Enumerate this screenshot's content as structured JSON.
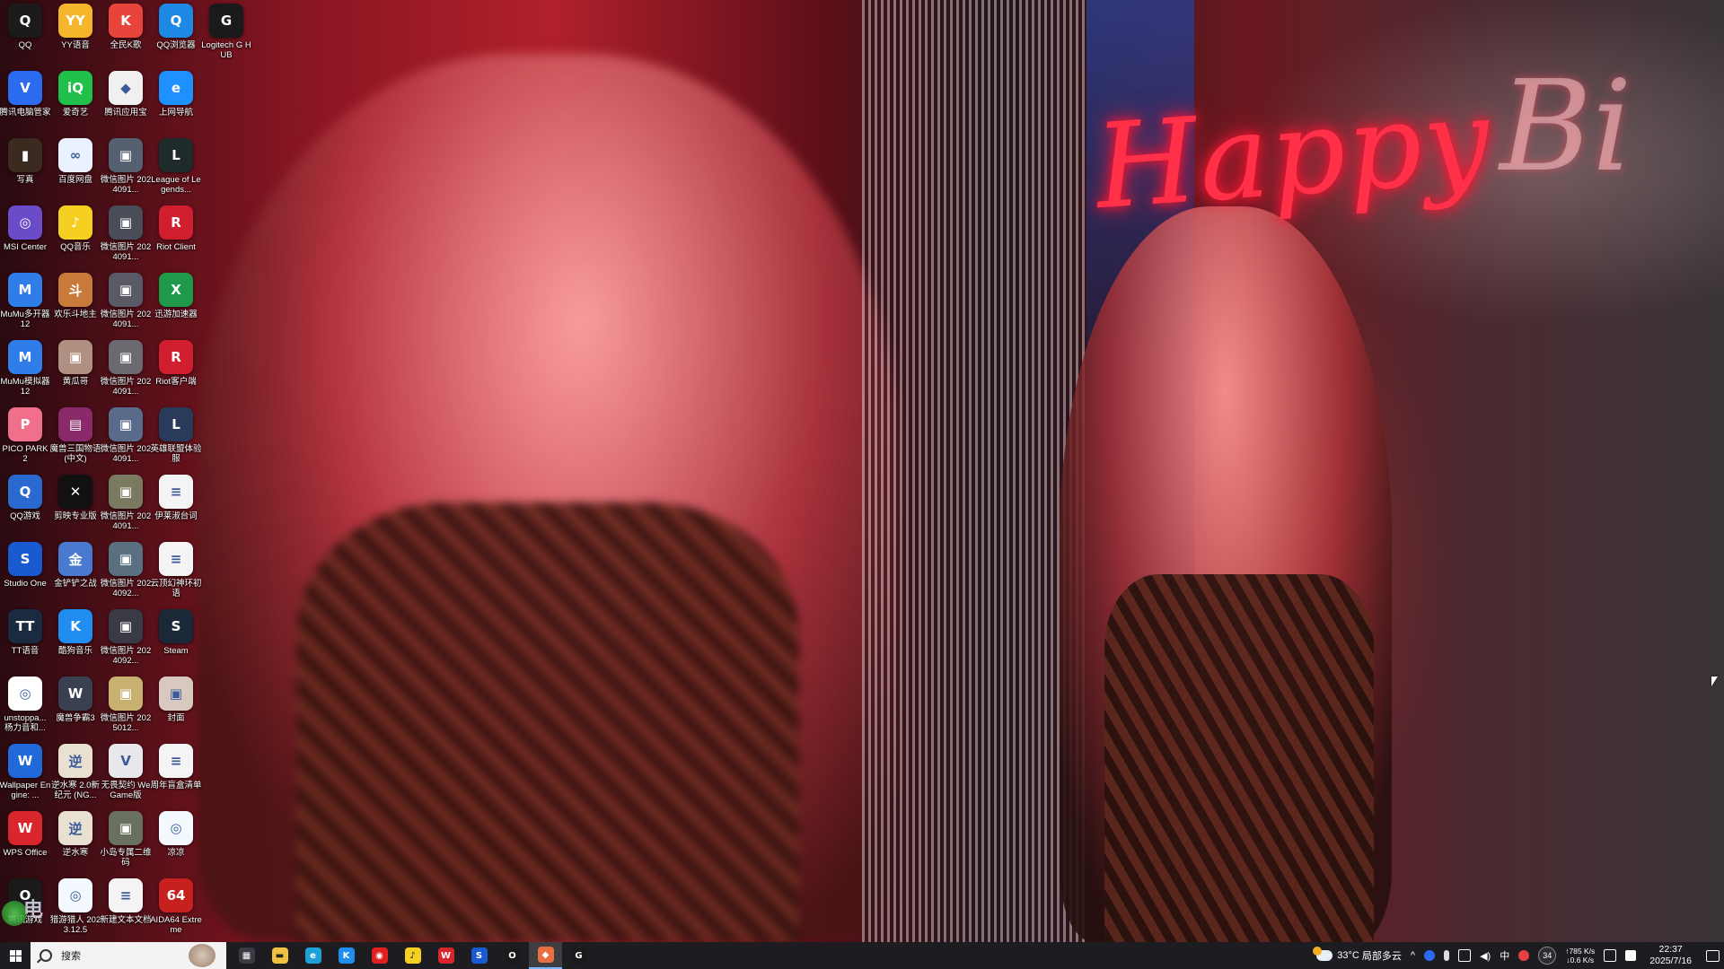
{
  "desktop": {
    "icons": [
      {
        "label": "QQ",
        "icon": "qq-icon",
        "color": "#1b1b1b",
        "glyph": "Q"
      },
      {
        "label": "YY语音",
        "icon": "yy-icon",
        "color": "#f5b62b",
        "glyph": "YY"
      },
      {
        "label": "全民K歌",
        "icon": "kge-icon",
        "color": "#e8443b",
        "glyph": "K"
      },
      {
        "label": "QQ浏览器",
        "icon": "qqbrowser-icon",
        "color": "#1e88e5",
        "glyph": "Q"
      },
      {
        "label": "Logitech G HUB",
        "icon": "logitech-icon",
        "color": "#1a1a1a",
        "glyph": "G"
      },
      {
        "label": "腾讯电脑管家",
        "icon": "tencent-guard-icon",
        "color": "#2a6bf0",
        "glyph": "V"
      },
      {
        "label": "爱奇艺",
        "icon": "iqiyi-icon",
        "color": "#20c04a",
        "glyph": "iQ"
      },
      {
        "label": "腾讯应用宝",
        "icon": "yingyongbao-icon",
        "color": "#f0f0f0",
        "glyph": "◆"
      },
      {
        "label": "上网导航",
        "icon": "ie-icon",
        "color": "#1e90ff",
        "glyph": "e"
      },
      {
        "label": "写真",
        "icon": "photo-icon",
        "color": "#3a2a20",
        "glyph": "▮"
      },
      {
        "label": "百度网盘",
        "icon": "baidu-netdisk-icon",
        "color": "#eaf2ff",
        "glyph": "∞"
      },
      {
        "label": "微信图片 2024091...",
        "icon": "image-file-icon",
        "color": "#556070",
        "glyph": "▣"
      },
      {
        "label": "League of Legends...",
        "icon": "lol-icon",
        "color": "#1f2a2a",
        "glyph": "L"
      },
      {
        "label": "MSI Center",
        "icon": "msi-icon",
        "color": "#6a4cc8",
        "glyph": "◎"
      },
      {
        "label": "QQ音乐",
        "icon": "qqmusic-icon",
        "color": "#f5d020",
        "glyph": "♪"
      },
      {
        "label": "微信图片 2024091...",
        "icon": "image-file-icon",
        "color": "#4a4c58",
        "glyph": "▣"
      },
      {
        "label": "Riot Client",
        "icon": "riot-icon",
        "color": "#d01e2e",
        "glyph": "R"
      },
      {
        "label": "MuMu多开器12",
        "icon": "mumu-icon",
        "color": "#2f7de8",
        "glyph": "M"
      },
      {
        "label": "欢乐斗地主",
        "icon": "doudizhu-icon",
        "color": "#c87a3a",
        "glyph": "斗"
      },
      {
        "label": "微信图片 2024091...",
        "icon": "image-file-icon",
        "color": "#5a5a66",
        "glyph": "▣"
      },
      {
        "label": "迅游加速器",
        "icon": "xunyou-icon",
        "color": "#1f9a4a",
        "glyph": "X"
      },
      {
        "label": "MuMu模拟器12",
        "icon": "mumu-emulator-icon",
        "color": "#2f7de8",
        "glyph": "M"
      },
      {
        "label": "黄瓜哥",
        "icon": "image-file-icon",
        "color": "#b09080",
        "glyph": "▣"
      },
      {
        "label": "微信图片 2024091...",
        "icon": "image-file-icon",
        "color": "#6a6a70",
        "glyph": "▣"
      },
      {
        "label": "Riot客户端",
        "icon": "riot-icon",
        "color": "#d01e2e",
        "glyph": "R"
      },
      {
        "label": "PICO PARK 2",
        "icon": "picopark-icon",
        "color": "#f06f8a",
        "glyph": "P"
      },
      {
        "label": "魔兽三国物语(中文)",
        "icon": "winrar-icon",
        "color": "#8a2a6a",
        "glyph": "▤"
      },
      {
        "label": "微信图片 2024091...",
        "icon": "image-file-icon",
        "color": "#5a6a8a",
        "glyph": "▣"
      },
      {
        "label": "英雄联盟体验服",
        "icon": "lol-pbe-icon",
        "color": "#2a3a5a",
        "glyph": "L"
      },
      {
        "label": "QQ游戏",
        "icon": "qqgame-icon",
        "color": "#2a6ad0",
        "glyph": "Q"
      },
      {
        "label": "剪映专业版",
        "icon": "capcut-icon",
        "color": "#111111",
        "glyph": "✕"
      },
      {
        "label": "微信图片 2024091...",
        "icon": "image-file-icon",
        "color": "#7a7a60",
        "glyph": "▣"
      },
      {
        "label": "伊莱淑台词",
        "icon": "text-file-icon",
        "color": "#f4f4f4",
        "glyph": "≡"
      },
      {
        "label": "Studio One",
        "icon": "studio-one-icon",
        "color": "#1a5ad0",
        "glyph": "S"
      },
      {
        "label": "金铲铲之战",
        "icon": "jinchanchan-icon",
        "color": "#4a7ad0",
        "glyph": "金"
      },
      {
        "label": "微信图片 2024092...",
        "icon": "image-file-icon",
        "color": "#5a7080",
        "glyph": "▣"
      },
      {
        "label": "云顶幻神环初语",
        "icon": "text-file-icon",
        "color": "#f4f4f4",
        "glyph": "≡"
      },
      {
        "label": "TT语音",
        "icon": "tt-icon",
        "color": "#1a2a40",
        "glyph": "TT"
      },
      {
        "label": "酷狗音乐",
        "icon": "kugou-icon",
        "color": "#1f8ef0",
        "glyph": "K"
      },
      {
        "label": "微信图片 2024092...",
        "icon": "image-file-icon",
        "color": "#3a3a44",
        "glyph": "▣"
      },
      {
        "label": "Steam",
        "icon": "steam-icon",
        "color": "#1b2838",
        "glyph": "S"
      },
      {
        "label": "unstoppa... 杨力音和...",
        "icon": "unstoppable-icon",
        "color": "#ffffff",
        "glyph": "◎"
      },
      {
        "label": "魔兽争霸3",
        "icon": "warcraft-icon",
        "color": "#3a4050",
        "glyph": "W"
      },
      {
        "label": "微信图片 2025012...",
        "icon": "image-file-icon",
        "color": "#c8b070",
        "glyph": "▣"
      },
      {
        "label": "封面",
        "icon": "image-file-icon",
        "color": "#d8c8c0",
        "glyph": "▣"
      },
      {
        "label": "Wallpaper Engine: ...",
        "icon": "wallpaper-engine-icon",
        "color": "#1f6ad8",
        "glyph": "W"
      },
      {
        "label": "逆水寒 2.0新纪元 (NG...",
        "icon": "nishuihan-icon",
        "color": "#e8e0d0",
        "glyph": "逆"
      },
      {
        "label": "无畏契约 WeGame版",
        "icon": "valorant-icon",
        "color": "#e8e8ec",
        "glyph": "V"
      },
      {
        "label": "周年盲盒清单",
        "icon": "text-file-icon",
        "color": "#f4f4f4",
        "glyph": "≡"
      },
      {
        "label": "WPS Office",
        "icon": "wps-icon",
        "color": "#d8262c",
        "glyph": "W"
      },
      {
        "label": "逆水寒",
        "icon": "nishuihan-icon",
        "color": "#e8e0d0",
        "glyph": "逆"
      },
      {
        "label": "小岛专属二维码",
        "icon": "image-file-icon",
        "color": "#6a7060",
        "glyph": "▣"
      },
      {
        "label": "凉凉",
        "icon": "audio-file-icon",
        "color": "#f4f8ff",
        "glyph": "◎"
      },
      {
        "label": "腾讯游戏",
        "icon": "tgp-icon",
        "color": "#1a1a1a",
        "glyph": "O"
      },
      {
        "label": "猎游猎人 2023.12.5",
        "icon": "app-file-icon",
        "color": "#f4f8ff",
        "glyph": "◎"
      },
      {
        "label": "新建文本文档",
        "icon": "text-file-icon",
        "color": "#f4f4f4",
        "glyph": "≡"
      },
      {
        "label": "AIDA64 Extreme",
        "icon": "aida64-icon",
        "color": "#c8201e",
        "glyph": "64"
      }
    ]
  },
  "wallpaper": {
    "neon_text": "Happy",
    "neon_text_2": "Bi"
  },
  "taskbar": {
    "search_placeholder": "搜索",
    "apps": [
      {
        "name": "task-view-icon",
        "color": "#3a3a44",
        "glyph": "▦"
      },
      {
        "name": "file-explorer-icon",
        "color": "#f0c040",
        "glyph": "▬"
      },
      {
        "name": "edge-icon",
        "color": "#1fa0d8",
        "glyph": "e"
      },
      {
        "name": "kugou-icon",
        "color": "#1f8ef0",
        "glyph": "K"
      },
      {
        "name": "netease-music-icon",
        "color": "#e02020",
        "glyph": "◉"
      },
      {
        "name": "qqmusic-icon",
        "color": "#f5d020",
        "glyph": "♪"
      },
      {
        "name": "wps-icon",
        "color": "#d8262c",
        "glyph": "W"
      },
      {
        "name": "studio-one-icon",
        "color": "#1a5ad0",
        "glyph": "S"
      },
      {
        "name": "tgp-icon",
        "color": "#1a1a1a",
        "glyph": "O"
      },
      {
        "name": "browser-icon",
        "color": "#e87040",
        "glyph": "◆"
      },
      {
        "name": "logitech-icon",
        "color": "#1a1a1a",
        "glyph": "G"
      }
    ],
    "active_app_index": 9,
    "weather": {
      "temp": "33°C",
      "desc": "局部多云"
    },
    "tray_badge": "34",
    "net_up": "↑785 K/s",
    "net_down": "↓0.6 K/s",
    "ime": "中",
    "time": "22:37",
    "date": "2025/7/16"
  }
}
